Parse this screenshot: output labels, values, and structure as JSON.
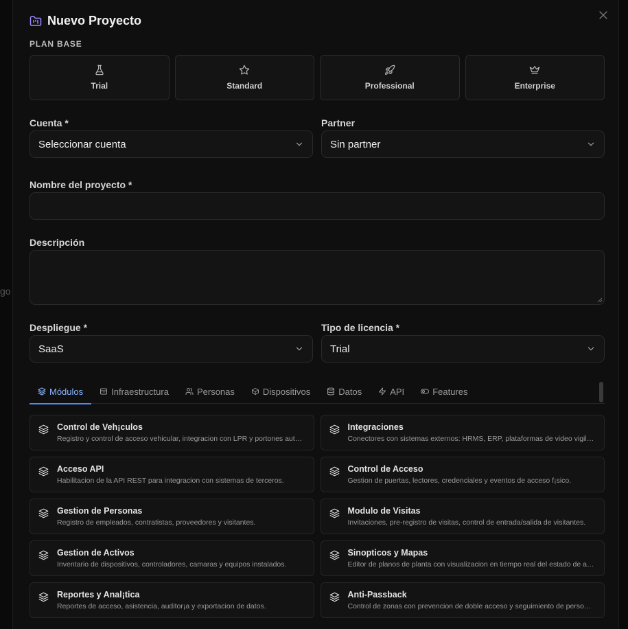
{
  "background": {
    "partial_text": "go"
  },
  "dialog": {
    "title": "Nuevo Proyecto",
    "close_label": "×"
  },
  "plan_section": {
    "label": "PLAN BASE",
    "plans": [
      {
        "label": "Trial",
        "icon": "flask-icon"
      },
      {
        "label": "Standard",
        "icon": "star-icon"
      },
      {
        "label": "Professional",
        "icon": "rocket-icon"
      },
      {
        "label": "Enterprise",
        "icon": "crown-icon"
      }
    ]
  },
  "form": {
    "cuenta": {
      "label": "Cuenta *",
      "value": "Seleccionar cuenta"
    },
    "partner": {
      "label": "Partner",
      "value": "Sin partner"
    },
    "nombre": {
      "label": "Nombre del proyecto *",
      "value": ""
    },
    "descripcion": {
      "label": "Descripción",
      "value": ""
    },
    "despliegue": {
      "label": "Despliegue *",
      "value": "SaaS"
    },
    "licencia": {
      "label": "Tipo de licencia *",
      "value": "Trial"
    }
  },
  "tabs": [
    {
      "label": "Módulos",
      "icon": "layers-icon",
      "active": true
    },
    {
      "label": "Infraestructura",
      "icon": "server-icon",
      "active": false
    },
    {
      "label": "Personas",
      "icon": "users-icon",
      "active": false
    },
    {
      "label": "Dispositivos",
      "icon": "box-icon",
      "active": false
    },
    {
      "label": "Datos",
      "icon": "database-icon",
      "active": false
    },
    {
      "label": "API",
      "icon": "zap-icon",
      "active": false
    },
    {
      "label": "Features",
      "icon": "toggle-icon",
      "active": false
    }
  ],
  "modules": [
    {
      "name": "Control de Veh¡culos",
      "desc": "Registro y control de acceso vehicular, integracion con LPR y portones aut…"
    },
    {
      "name": "Integraciones",
      "desc": "Conectores con sistemas externos: HRMS, ERP, plataformas de video vigil…"
    },
    {
      "name": "Acceso API",
      "desc": "Habilitacion de la API REST para integracion con sistemas de terceros."
    },
    {
      "name": "Control de Acceso",
      "desc": "Gestion de puertas, lectores, credenciales y eventos de acceso f¡sico."
    },
    {
      "name": "Gestion de Personas",
      "desc": "Registro de empleados, contratistas, proveedores y visitantes."
    },
    {
      "name": "Modulo de Visitas",
      "desc": "Invitaciones, pre-registro de visitas, control de entrada/salida de visitantes."
    },
    {
      "name": "Gestion de Activos",
      "desc": "Inventario de dispositivos, controladores, camaras y equipos instalados."
    },
    {
      "name": "Sinopticos y Mapas",
      "desc": "Editor de planos de planta con visualizacion en tiempo real del estado de a…"
    },
    {
      "name": "Reportes y Anal¡tica",
      "desc": "Reportes de acceso, asistencia, auditor¡a y exportacion de datos."
    },
    {
      "name": "Anti-Passback",
      "desc": "Control de zonas con prevencion de doble acceso y seguimiento de perso…"
    }
  ],
  "colors": {
    "accent": "#4a8cff",
    "surface": "#141414",
    "border": "#2a2a2a",
    "title_icon": "#9b8cff"
  }
}
